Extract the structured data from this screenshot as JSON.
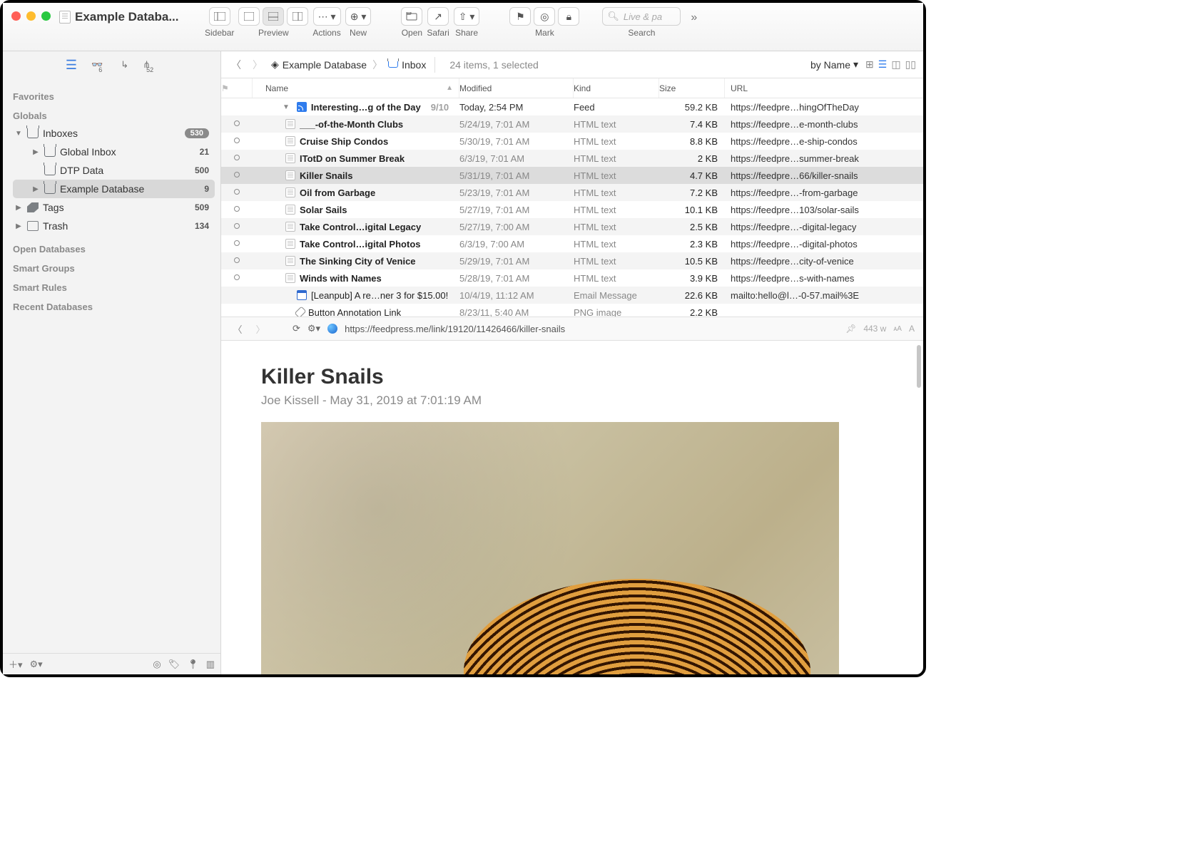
{
  "window": {
    "title": "Example Databa..."
  },
  "toolbar": {
    "sidebar": "Sidebar",
    "preview": "Preview",
    "actions": "Actions",
    "new": "New",
    "open": "Open",
    "safari": "Safari",
    "share": "Share",
    "mark": "Mark",
    "search": "Search",
    "search_placeholder": "Live & pa"
  },
  "sidebar_toolbar": {
    "count1": "6",
    "count2": "52"
  },
  "sidebar": {
    "favorites": "Favorites",
    "globals": "Globals",
    "inboxes": {
      "label": "Inboxes",
      "count": "530"
    },
    "global_inbox": {
      "label": "Global Inbox",
      "count": "21"
    },
    "dtp_data": {
      "label": "DTP Data",
      "count": "500"
    },
    "example_db": {
      "label": "Example Database",
      "count": "9"
    },
    "tags": {
      "label": "Tags",
      "count": "509"
    },
    "trash": {
      "label": "Trash",
      "count": "134"
    },
    "open_db": "Open Databases",
    "smart_groups": "Smart Groups",
    "smart_rules": "Smart Rules",
    "recent_db": "Recent Databases"
  },
  "pathbar": {
    "crumb1": "Example Database",
    "crumb2": "Inbox",
    "status": "24 items, 1 selected",
    "sort": "by Name"
  },
  "columns": {
    "name": "Name",
    "modified": "Modified",
    "kind": "Kind",
    "size": "Size",
    "url": "URL"
  },
  "group": {
    "name": "Interesting…g of the Day",
    "count": "9/10",
    "modified": "Today, 2:54 PM",
    "kind": "Feed",
    "size": "59.2 KB",
    "url": "https://feedpre…hingOfTheDay"
  },
  "rows": [
    {
      "name": "___-of-the-Month Clubs",
      "mod": "5/24/19, 7:01 AM",
      "kind": "HTML text",
      "size": "7.4 KB",
      "url": "https://feedpre…e-month-clubs",
      "unread": true
    },
    {
      "name": "Cruise Ship Condos",
      "mod": "5/30/19, 7:01 AM",
      "kind": "HTML text",
      "size": "8.8 KB",
      "url": "https://feedpre…e-ship-condos",
      "unread": true
    },
    {
      "name": "ITotD on Summer Break",
      "mod": "6/3/19, 7:01 AM",
      "kind": "HTML text",
      "size": "2 KB",
      "url": "https://feedpre…summer-break",
      "unread": true
    },
    {
      "name": "Killer Snails",
      "mod": "5/31/19, 7:01 AM",
      "kind": "HTML text",
      "size": "4.7 KB",
      "url": "https://feedpre…66/killer-snails",
      "unread": true,
      "selected": true
    },
    {
      "name": "Oil from Garbage",
      "mod": "5/23/19, 7:01 AM",
      "kind": "HTML text",
      "size": "7.2 KB",
      "url": "https://feedpre…-from-garbage",
      "unread": true
    },
    {
      "name": "Solar Sails",
      "mod": "5/27/19, 7:01 AM",
      "kind": "HTML text",
      "size": "10.1 KB",
      "url": "https://feedpre…103/solar-sails",
      "unread": true
    },
    {
      "name": "Take Control…igital Legacy",
      "mod": "5/27/19, 7:00 AM",
      "kind": "HTML text",
      "size": "2.5 KB",
      "url": "https://feedpre…-digital-legacy",
      "unread": true
    },
    {
      "name": "Take Control…igital Photos",
      "mod": "6/3/19, 7:00 AM",
      "kind": "HTML text",
      "size": "2.3 KB",
      "url": "https://feedpre…-digital-photos",
      "unread": true
    },
    {
      "name": "The Sinking City of Venice",
      "mod": "5/29/19, 7:01 AM",
      "kind": "HTML text",
      "size": "10.5 KB",
      "url": "https://feedpre…city-of-venice",
      "unread": true
    },
    {
      "name": "Winds with Names",
      "mod": "5/28/19, 7:01 AM",
      "kind": "HTML text",
      "size": "3.9 KB",
      "url": "https://feedpre…s-with-names",
      "unread": true
    }
  ],
  "extra_rows": [
    {
      "icon": "cal",
      "name": "[Leanpub] A re…ner 3 for $15.00!",
      "mod": "10/4/19, 11:12 AM",
      "kind": "Email Message",
      "size": "22.6 KB",
      "url": "mailto:hello@l…-0-57.mail%3E"
    },
    {
      "icon": "clip",
      "name": "Button Annotation Link",
      "mod": "8/23/11, 5:40 AM",
      "kind": "PNG image",
      "size": "2.2 KB",
      "url": ""
    }
  ],
  "preview": {
    "url": "https://feedpress.me/link/19120/11426466/killer-snails",
    "words": "443 w",
    "title": "Killer Snails",
    "byline": "Joe Kissell - May 31, 2019 at 7:01:19 AM"
  }
}
